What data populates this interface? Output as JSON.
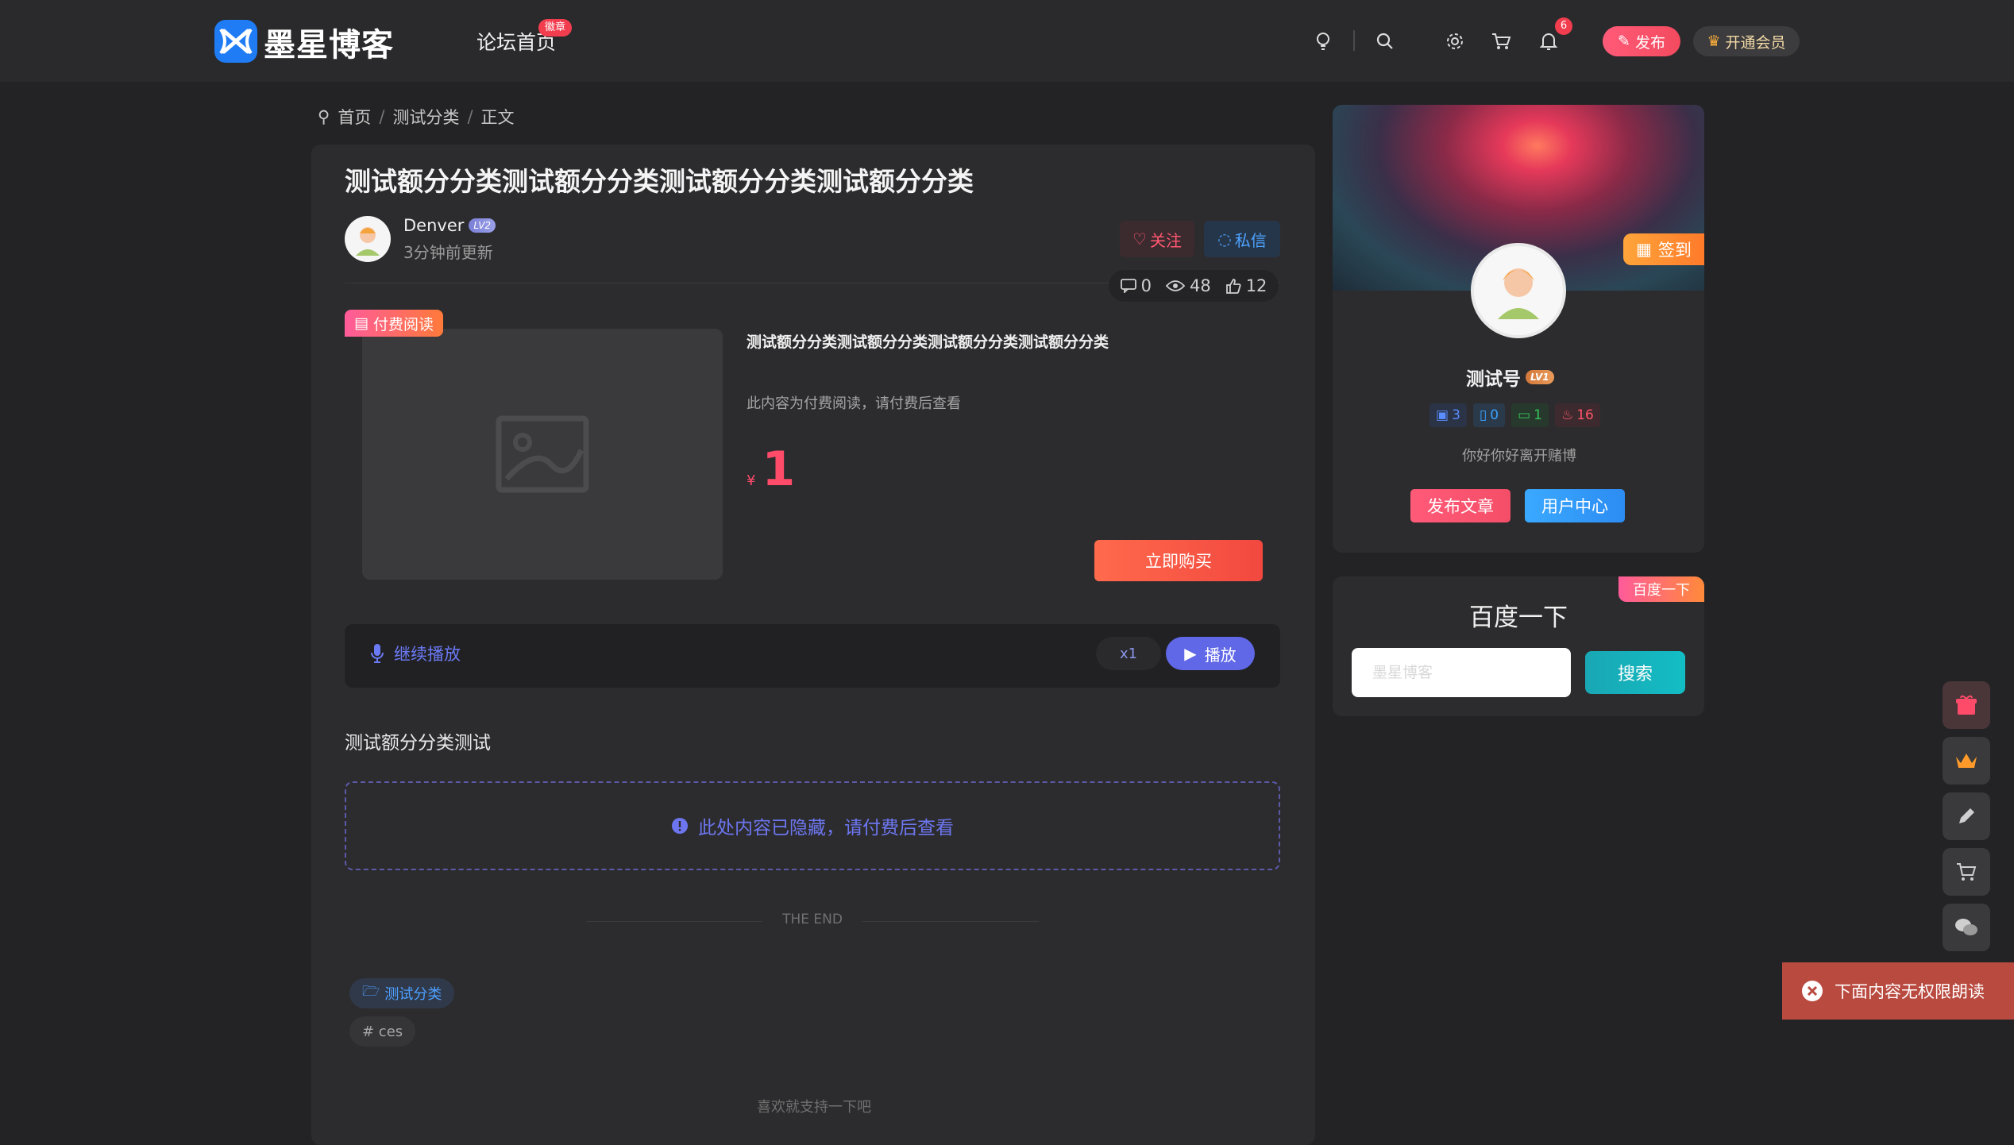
{
  "header": {
    "logo_text": "墨星博客",
    "nav_home": "论坛首页",
    "nav_badge": "徽章",
    "notification_count": "6",
    "publish_label": "发布",
    "vip_label": "开通会员"
  },
  "breadcrumb": {
    "home": "首页",
    "category": "测试分类",
    "current": "正文"
  },
  "post": {
    "title": "测试额分分类测试额分分类测试额分分类测试额分分类",
    "author": "Denver",
    "author_level": "LV2",
    "updated": "3分钟前更新",
    "follow_label": "关注",
    "message_label": "私信",
    "stats": {
      "comments": "0",
      "views": "48",
      "likes": "12"
    }
  },
  "paid": {
    "tag": "付费阅读",
    "title": "测试额分分类测试额分分类测试额分分类测试额分分类",
    "desc": "此内容为付费阅读，请付费后查看",
    "currency": "¥",
    "price": "1",
    "buy_label": "立即购买"
  },
  "audio": {
    "label": "继续播放",
    "speed": "x1",
    "play_label": "播放"
  },
  "content": {
    "text": "测试额分分类测试",
    "hidden_notice": "此处内容已隐藏，请付费后查看",
    "end_text": "THE END",
    "category_tag": "测试分类",
    "hash_tag": "# ces",
    "support_text": "喜欢就支持一下吧"
  },
  "sidebar": {
    "checkin_label": "签到",
    "name": "测试号",
    "level": "LV1",
    "stats": [
      "3",
      "0",
      "1",
      "16"
    ],
    "motto": "你好你好离开赌博",
    "write_label": "发布文章",
    "center_label": "用户中心",
    "search_ribbon": "百度一下",
    "search_title": "百度一下",
    "search_placeholder": "墨星博客",
    "search_button": "搜索"
  },
  "toast": {
    "text": "下面内容无权限朗读"
  },
  "colors": {
    "accent": "#6068e8",
    "pink": "#ff4b6a",
    "blue": "#4ea3ff",
    "teal": "#13bdc4"
  }
}
